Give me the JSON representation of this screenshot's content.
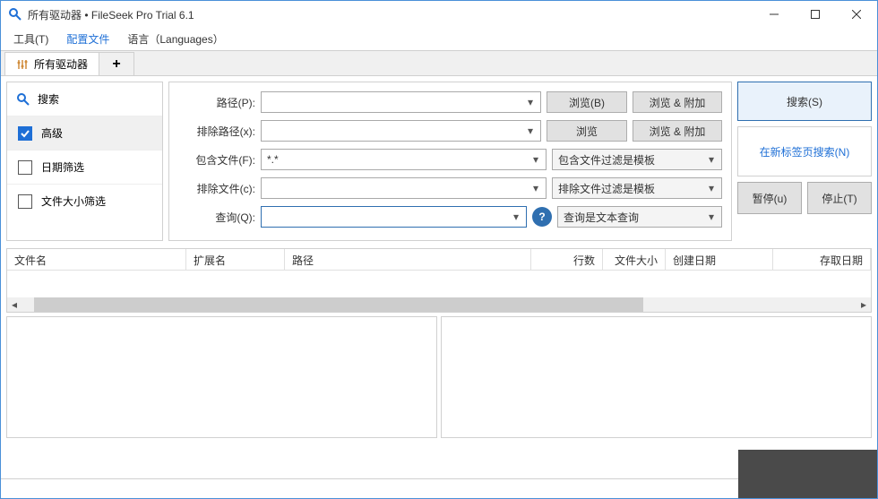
{
  "window": {
    "title": "所有驱动器 • FileSeek Pro Trial 6.1"
  },
  "menu": {
    "tools": "工具(T)",
    "profiles": "配置文件",
    "language": "语言（Languages）"
  },
  "tabs": {
    "main": "所有驱动器"
  },
  "sidebar": {
    "search": "搜索",
    "advanced": "高级",
    "datefilter": "日期筛选",
    "sizefilter": "文件大小筛选"
  },
  "form": {
    "path_label": "路径(P):",
    "path_value": "",
    "browse_b": "浏览(B)",
    "browse_append": "浏览 & 附加",
    "exclude_path_label": "排除路径(x):",
    "exclude_path_value": "",
    "browse": "浏览",
    "include_label": "包含文件(F):",
    "include_value": "*.*",
    "include_template": "包含文件过滤是模板",
    "exclude_file_label": "排除文件(c):",
    "exclude_file_value": "",
    "exclude_template": "排除文件过滤是模板",
    "query_label": "查询(Q):",
    "query_value": "",
    "query_mode": "查询是文本查询"
  },
  "actions": {
    "search": "搜索(S)",
    "search_newtab": "在新标签页搜索(N)",
    "pause": "暂停(u)",
    "stop": "停止(T)"
  },
  "columns": {
    "filename": "文件名",
    "ext": "扩展名",
    "path": "路径",
    "lines": "行数",
    "size": "文件大小",
    "created": "创建日期",
    "accessed": "存取日期"
  }
}
